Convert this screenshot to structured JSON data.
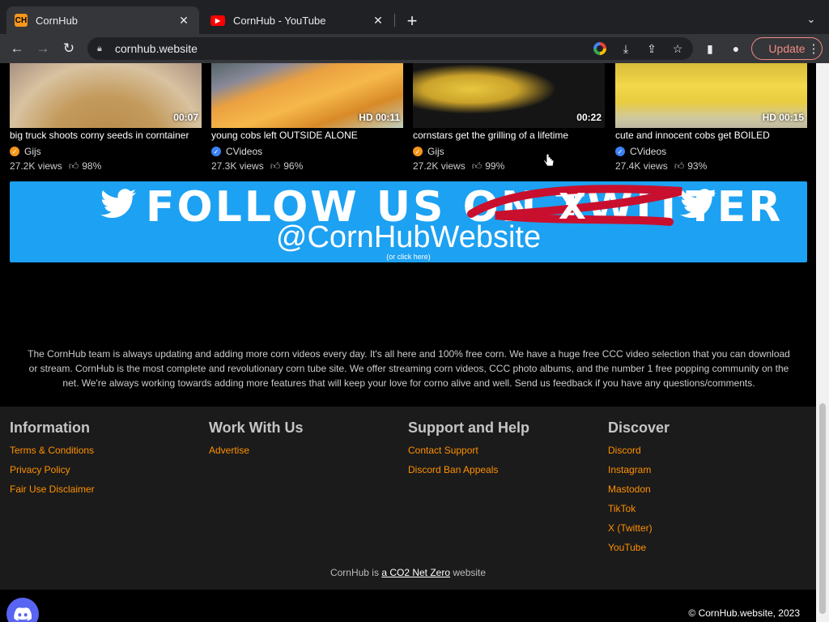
{
  "browser": {
    "tabs": [
      {
        "title": "CornHub",
        "favicon": "cornhub-favicon",
        "active": true
      },
      {
        "title": "CornHub - YouTube",
        "favicon": "youtube-favicon",
        "active": false
      }
    ],
    "url": "cornhub.website",
    "update_label": "Update"
  },
  "videos": [
    {
      "title": "big truck shoots corny seeds in corntainer",
      "channel": "Gijs",
      "verified_color": "#f7971d",
      "duration": "00:07",
      "views": "27.2K views",
      "rating": "98%"
    },
    {
      "title": "young cobs left OUTSIDE ALONE",
      "channel": "CVideos",
      "verified_color": "#3b82f6",
      "duration": "HD 00:11",
      "views": "27.3K views",
      "rating": "96%"
    },
    {
      "title": "cornstars get the grilling of a lifetime",
      "channel": "Gijs",
      "verified_color": "#f7971d",
      "duration": "00:22",
      "views": "27.2K views",
      "rating": "99%"
    },
    {
      "title": "cute and innocent cobs get BOILED",
      "channel": "CVideos",
      "verified_color": "#3b82f6",
      "duration": "HD 00:15",
      "views": "27.4K views",
      "rating": "93%"
    }
  ],
  "banner": {
    "headline": "FOLLOW US ON TWITTER",
    "handle": "@CornHubWebsite",
    "click_here": "(or click here)",
    "strike_letter": "X",
    "background": "#1da1f2"
  },
  "about_text": "The CornHub team is always updating and adding more corn videos every day. It's all here and 100% free corn. We have a huge free CCC video selection that you can download or stream. CornHub is the most complete and revolutionary corn tube site. We offer streaming corn videos, CCC photo albums, and the number 1 free popping community on the net. We're always working towards adding more features that will keep your love for corno alive and well. Send us feedback if you have any questions/comments.",
  "footer": {
    "columns": [
      {
        "heading": "Information",
        "links": [
          "Terms & Conditions",
          "Privacy Policy",
          "Fair Use Disclaimer"
        ]
      },
      {
        "heading": "Work With Us",
        "links": [
          "Advertise"
        ]
      },
      {
        "heading": "Support and Help",
        "links": [
          "Contact Support",
          "Discord Ban Appeals"
        ]
      },
      {
        "heading": "Discover",
        "links": [
          "Discord",
          "Instagram",
          "Mastodon",
          "TikTok",
          "X (Twitter)",
          "YouTube"
        ]
      }
    ],
    "netzero_prefix": "CornHub is ",
    "netzero_link": "a CO2 Net Zero",
    "netzero_suffix": " website",
    "copyright": "© CornHub.website, 2023",
    "link_color": "#ff9000"
  }
}
